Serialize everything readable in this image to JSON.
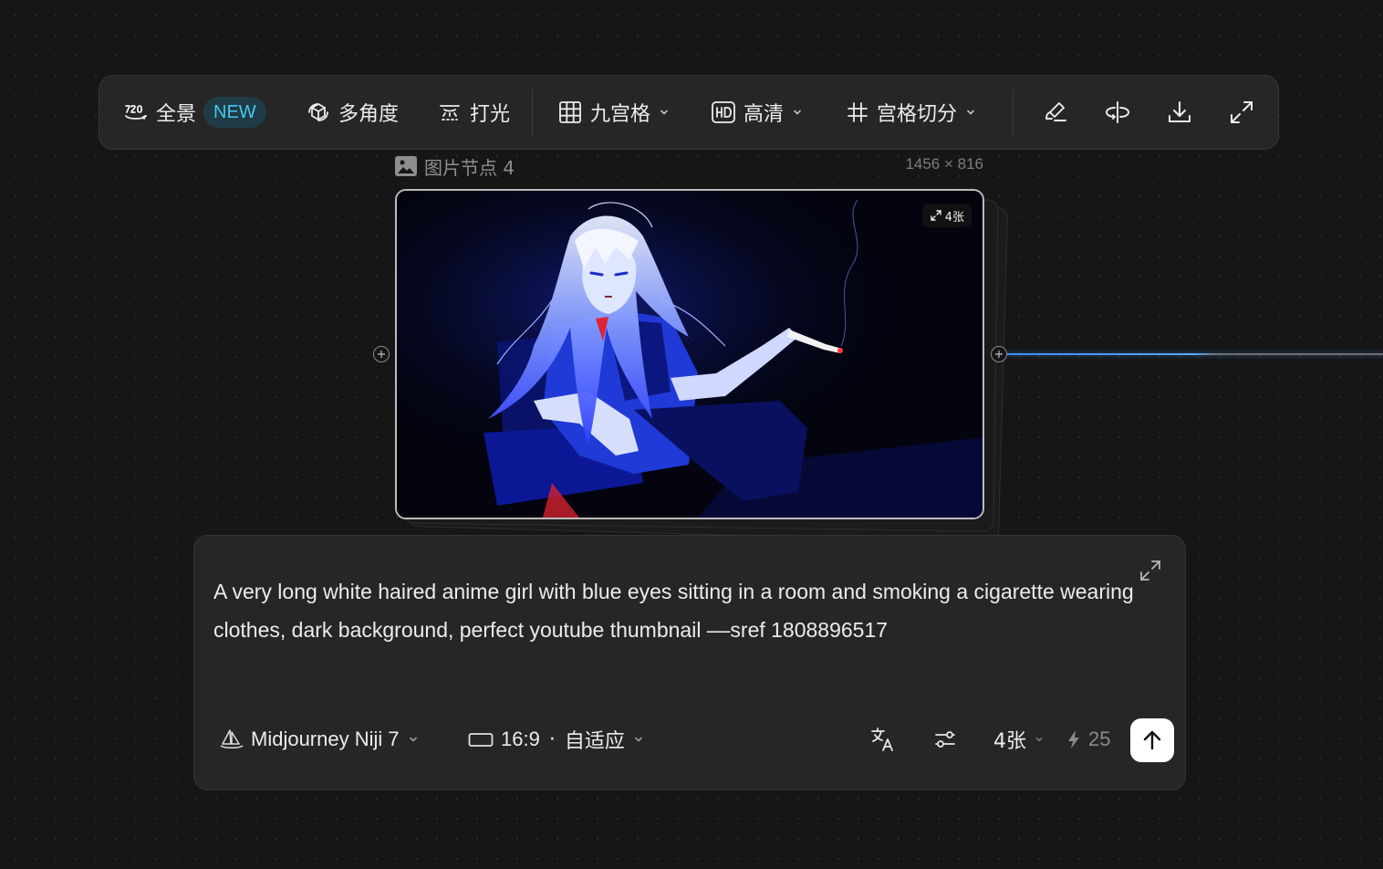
{
  "toolbar": {
    "panorama_label": "全景",
    "panorama_badge": "NEW",
    "multiangle_label": "多角度",
    "lighting_label": "打光",
    "grid_label": "九宫格",
    "hd_label": "高清",
    "split_label": "宫格切分"
  },
  "node": {
    "title": "图片节点 4",
    "dimensions": "1456 × 816",
    "image_count": "4张"
  },
  "prompt": {
    "text": "A very long white haired anime girl with blue eyes sitting in a room and smoking a cigarette wearing clothes, dark background, perfect youtube thumbnail ––sref 1808896517",
    "model": "Midjourney Niji 7",
    "ratio": "16:9",
    "ratio_separator": "·",
    "ratio_mode": "自适应",
    "count": "4张",
    "credits": "25"
  },
  "colors": {
    "accent": "#47c6f0",
    "connector": "#3a8dff"
  }
}
